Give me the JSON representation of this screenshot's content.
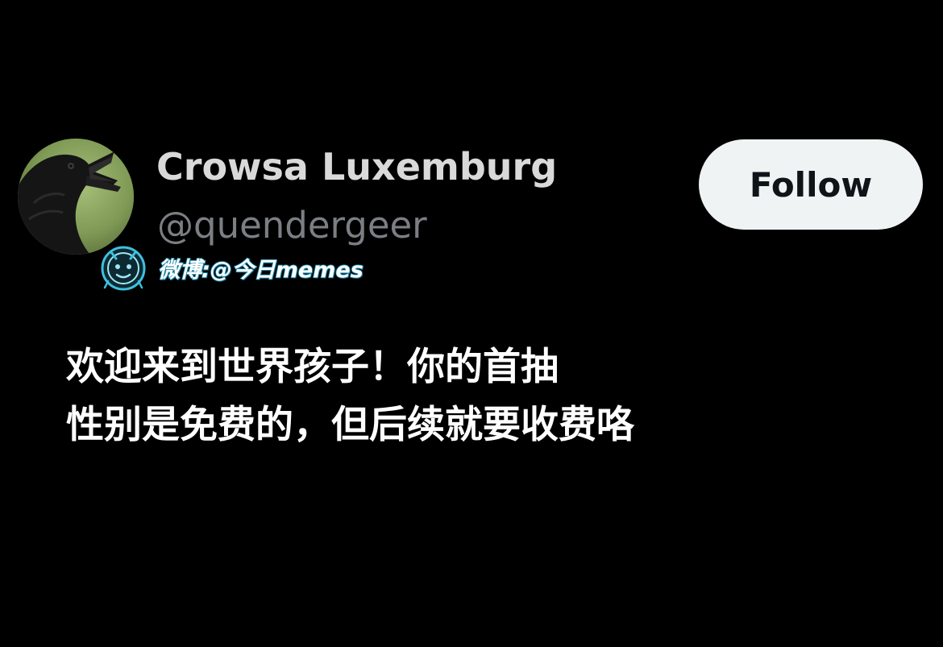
{
  "profile": {
    "display_name": "Crowsa Luxemburg",
    "handle": "@quendergeer",
    "avatar_icon": "crow-avatar"
  },
  "follow_button": {
    "label": "Follow"
  },
  "watermark": {
    "text": "微博:@今日memes",
    "icon": "weibo-mascot-icon"
  },
  "post": {
    "lines": [
      "欢迎来到世界孩子！你的首抽",
      "性别是免费的，但后续就要收费咯"
    ]
  },
  "colors": {
    "background": "#000000",
    "display_name": "#d9d9d9",
    "handle": "#7b7f84",
    "follow_bg": "#eff3f4",
    "follow_text": "#0f1419",
    "watermark_outline": "#2aa3c7"
  }
}
